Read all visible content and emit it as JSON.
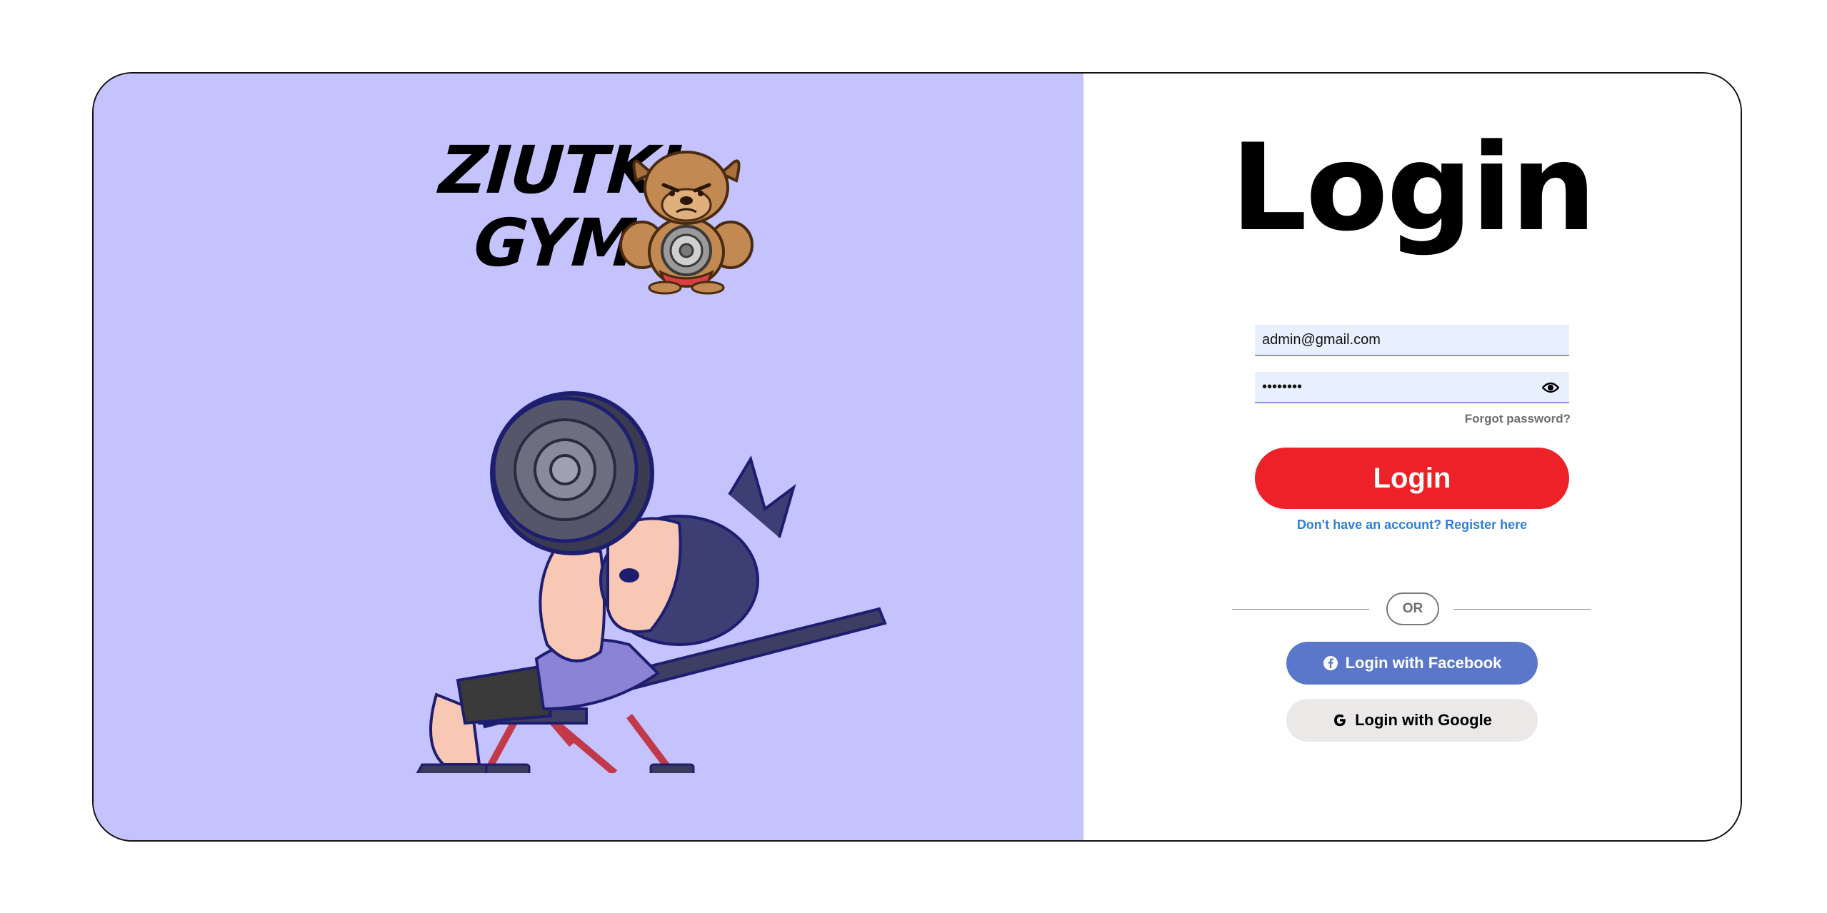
{
  "brand": {
    "line1": "ZIUTKI",
    "line2": "GYM"
  },
  "login": {
    "title": "Login",
    "email_value": "admin@gmail.com",
    "password_value": "••••••••",
    "forgot_label": "Forgot password?",
    "submit_label": "Login",
    "register_label": "Don't have an account? Register here",
    "divider_label": "OR",
    "facebook_label": "Login with Facebook",
    "google_label": "Login with Google"
  },
  "icons": {
    "eye": "eye-icon",
    "facebook": "facebook-icon",
    "google": "google-icon",
    "mascot": "bulldog-mascot-illustration",
    "hero": "bench-press-illustration"
  },
  "colors": {
    "left_panel_bg": "#c5c3fd",
    "login_button": "#ed2229",
    "facebook_button": "#5b77c9",
    "google_button": "#ebe8e8",
    "link": "#2f7fd6",
    "input_bg": "#e8f0fe"
  }
}
